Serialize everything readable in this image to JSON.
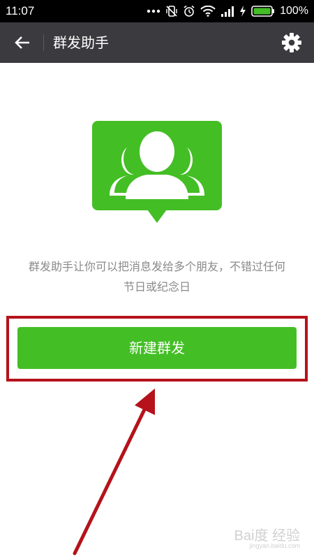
{
  "status_bar": {
    "time": "11:07",
    "battery_percent": "100%",
    "icons": [
      "more-dots-icon",
      "vibrate-icon",
      "alarm-icon",
      "wifi-icon",
      "signal-icon",
      "charging-icon",
      "battery-icon"
    ]
  },
  "header": {
    "back_icon": "back-arrow-icon",
    "title": "群发助手",
    "settings_icon": "gear-icon"
  },
  "hero": {
    "icon": "group-contacts-icon",
    "icon_color": "#44be25"
  },
  "description": {
    "line1": "群发助手让你可以把消息发给多个朋友，不错过任何",
    "line2": "节日或纪念日"
  },
  "primary_button": {
    "label": "新建群发",
    "color": "#44be25"
  },
  "annotation": {
    "highlight_color": "#b5121b"
  },
  "watermark": {
    "text": "Bai度 经验",
    "sub": "jingyan.baidu.com"
  }
}
